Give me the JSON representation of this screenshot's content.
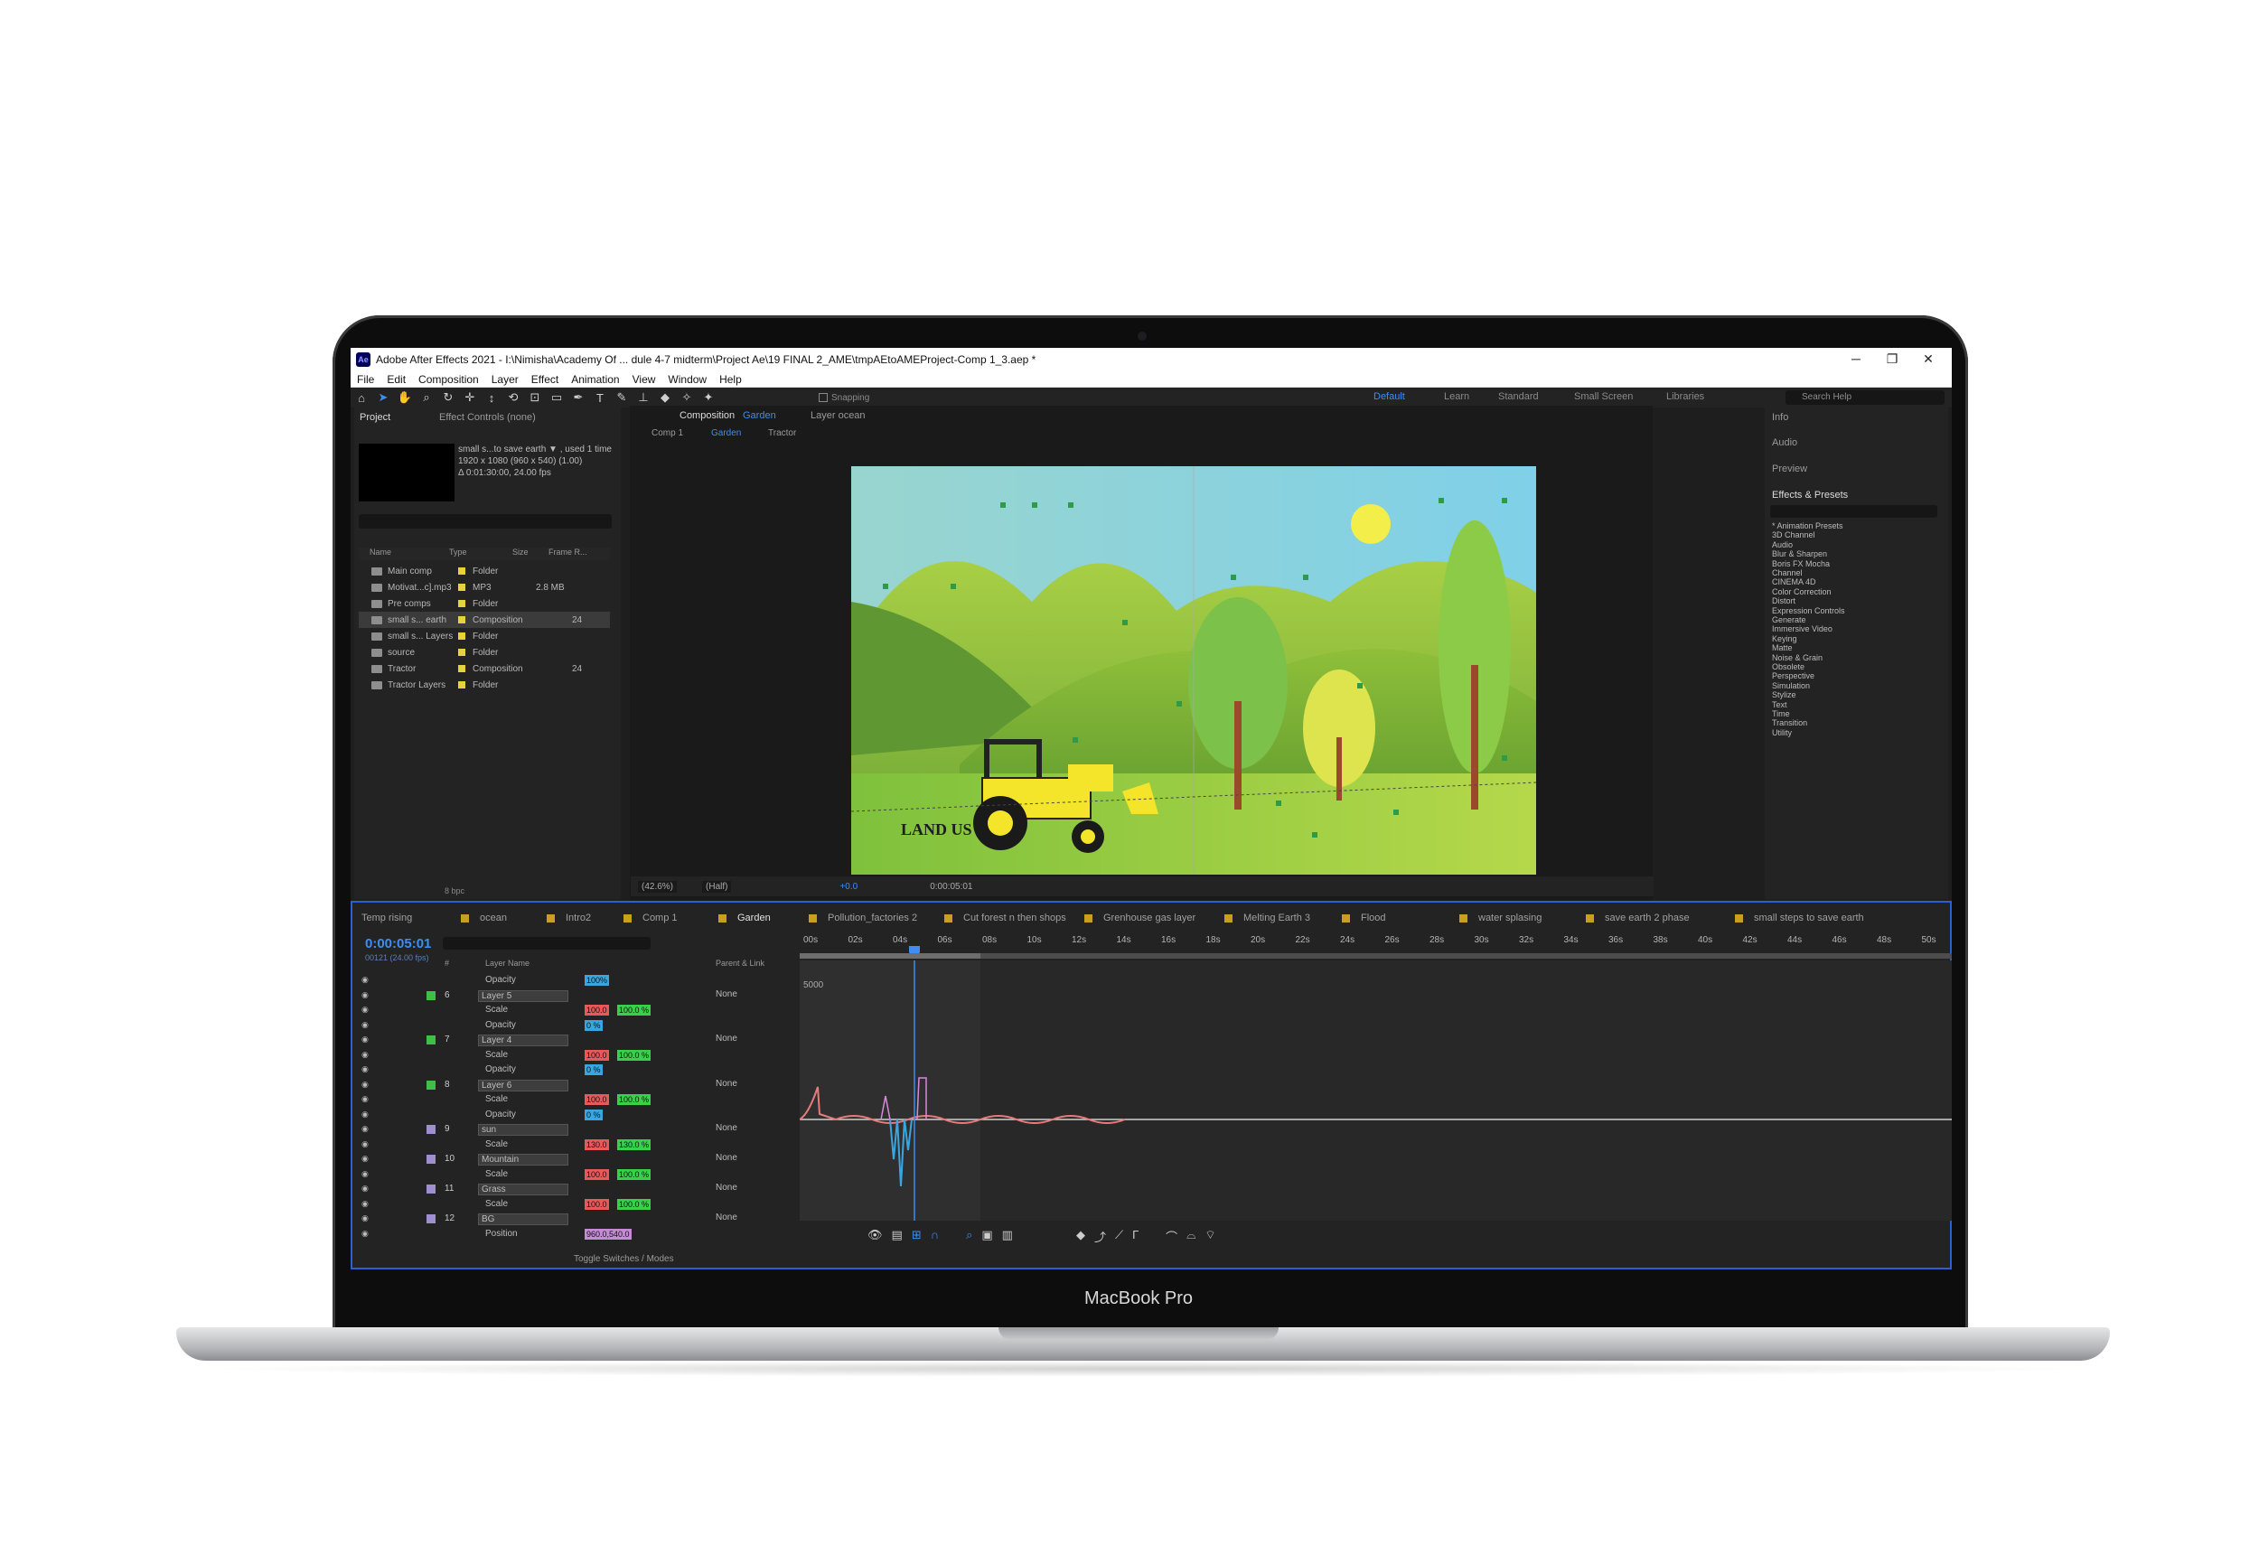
{
  "device": {
    "brand_label": "MacBook Pro"
  },
  "window": {
    "title": "Adobe After Effects 2021 - I:\\Nimisha\\Academy Of ... dule 4-7 midterm\\Project Ae\\19 FINAL 2_AME\\tmpAEtoAMEProject-Comp 1_3.aep *",
    "controls": [
      "─",
      "❐",
      "✕"
    ]
  },
  "menu": [
    "File",
    "Edit",
    "Composition",
    "Layer",
    "Effect",
    "Animation",
    "View",
    "Window",
    "Help"
  ],
  "toolbar": {
    "snapping_label": "Snapping",
    "workspaces": [
      "Default",
      "Learn",
      "Standard",
      "Small Screen",
      "Libraries"
    ],
    "search_help_placeholder": "Search Help"
  },
  "project_panel": {
    "tabs": [
      "Project",
      "Effect Controls (none)"
    ],
    "selected_info": [
      "small s...to save earth ▼ , used 1 time",
      "1920 x 1080  (960 x 540) (1.00)",
      "Δ 0:01:30:00, 24.00 fps"
    ],
    "columns": [
      "Name",
      "Type",
      "Size",
      "Frame R..."
    ],
    "items": [
      {
        "name": "Main comp",
        "type": "Folder",
        "size": "",
        "fr": ""
      },
      {
        "name": "Motivat...c].mp3",
        "type": "MP3",
        "size": "2.8 MB",
        "fr": ""
      },
      {
        "name": "Pre comps",
        "type": "Folder",
        "size": "",
        "fr": ""
      },
      {
        "name": "small s... earth",
        "type": "Composition",
        "size": "",
        "fr": "24"
      },
      {
        "name": "small s... Layers",
        "type": "Folder",
        "size": "",
        "fr": ""
      },
      {
        "name": "source",
        "type": "Folder",
        "size": "",
        "fr": ""
      },
      {
        "name": "Tractor",
        "type": "Composition",
        "size": "",
        "fr": "24"
      },
      {
        "name": "Tractor Layers",
        "type": "Folder",
        "size": "",
        "fr": ""
      }
    ],
    "bpc": "8 bpc"
  },
  "composition_panel": {
    "tab_prefix": "Composition",
    "tab_name": "Garden",
    "layer_tab": "Layer  ocean",
    "breadcrumb": [
      "Comp 1",
      "Garden",
      "Tractor"
    ],
    "canvas_text": "LAND US",
    "zoom": "(42.6%)",
    "resolution": "(Half)",
    "exposure": "+0.0",
    "timecode": "0:00:05:01"
  },
  "right_panel": {
    "sections": [
      "Info",
      "Audio",
      "Preview",
      "Effects & Presets"
    ],
    "effects": [
      "* Animation Presets",
      "3D Channel",
      "Audio",
      "Blur & Sharpen",
      "Boris FX Mocha",
      "Channel",
      "CINEMA 4D",
      "Color Correction",
      "Distort",
      "Expression Controls",
      "Generate",
      "Immersive Video",
      "Keying",
      "Matte",
      "Noise & Grain",
      "Obsolete",
      "Perspective",
      "Simulation",
      "Stylize",
      "Text",
      "Time",
      "Transition",
      "Utility"
    ]
  },
  "timeline": {
    "tabs": [
      "Temp rising",
      "ocean",
      "Intro2",
      "Comp 1",
      "Garden",
      "Pollution_factories 2",
      "Cut forest n then shops",
      "Grenhouse gas layer",
      "Melting Earth 3",
      "Flood",
      "water splasing",
      "save earth 2 phase",
      "small steps to save earth"
    ],
    "active_tab": "Garden",
    "timecode": "0:00:05:01",
    "fps_label": "00121 (24.00 fps)",
    "column_labels": {
      "num": "#",
      "layer_name": "Layer Name",
      "parent": "Parent & Link"
    },
    "graph_value_label": "5000",
    "ruler": [
      "00s",
      "02s",
      "04s",
      "06s",
      "08s",
      "10s",
      "12s",
      "14s",
      "16s",
      "18s",
      "20s",
      "22s",
      "24s",
      "26s",
      "28s",
      "30s",
      "32s",
      "34s",
      "36s",
      "38s",
      "40s",
      "42s",
      "44s",
      "46s",
      "48s",
      "50s"
    ],
    "rows": [
      {
        "kind": "prop",
        "name": "Opacity",
        "values": [
          "100%"
        ]
      },
      {
        "kind": "layer",
        "num": "6",
        "name": "Layer 5",
        "parent": "None",
        "color": "#3fbf4a"
      },
      {
        "kind": "prop",
        "name": "Scale",
        "values": [
          "100.0",
          "100.0 %"
        ]
      },
      {
        "kind": "prop",
        "name": "Opacity",
        "values": [
          "0 %"
        ]
      },
      {
        "kind": "layer",
        "num": "7",
        "name": "Layer 4",
        "parent": "None",
        "color": "#3fbf4a"
      },
      {
        "kind": "prop",
        "name": "Scale",
        "values": [
          "100.0",
          "100.0 %"
        ]
      },
      {
        "kind": "prop",
        "name": "Opacity",
        "values": [
          "0 %"
        ]
      },
      {
        "kind": "layer",
        "num": "8",
        "name": "Layer 6",
        "parent": "None",
        "color": "#3fbf4a"
      },
      {
        "kind": "prop",
        "name": "Scale",
        "values": [
          "100.0",
          "100.0 %"
        ]
      },
      {
        "kind": "prop",
        "name": "Opacity",
        "values": [
          "0 %"
        ]
      },
      {
        "kind": "layer",
        "num": "9",
        "name": "sun",
        "parent": "None",
        "color": "#a08fd0"
      },
      {
        "kind": "prop",
        "name": "Scale",
        "values": [
          "130.0",
          "130.0 %"
        ]
      },
      {
        "kind": "layer",
        "num": "10",
        "name": "Mountain",
        "parent": "None",
        "color": "#a08fd0"
      },
      {
        "kind": "prop",
        "name": "Scale",
        "values": [
          "100.0",
          "100.0 %"
        ]
      },
      {
        "kind": "layer",
        "num": "11",
        "name": "Grass",
        "parent": "None",
        "color": "#a08fd0"
      },
      {
        "kind": "prop",
        "name": "Scale",
        "values": [
          "100.0",
          "100.0 %"
        ]
      },
      {
        "kind": "layer",
        "num": "12",
        "name": "BG",
        "parent": "None",
        "color": "#a08fd0"
      },
      {
        "kind": "prop",
        "name": "Position",
        "values": [
          "960.0,540.0"
        ]
      }
    ],
    "toggle_label": "Toggle Switches / Modes"
  },
  "colors": {
    "accent": "#2a5fd6",
    "timecode": "#3d8ef0",
    "folder_label": "#e8d23a",
    "value_red": "#e85a5a",
    "value_green": "#37d24a",
    "value_blue": "#3aa6e0",
    "value_purple": "#c58bd6"
  }
}
